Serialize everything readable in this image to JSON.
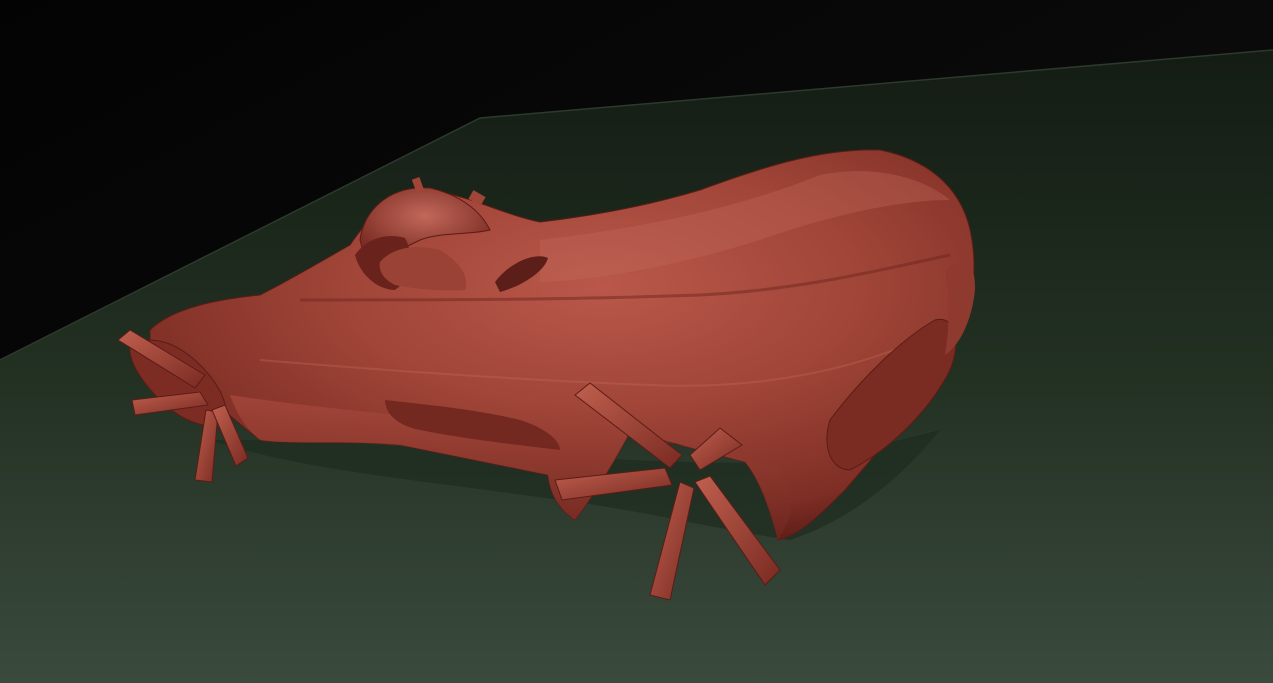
{
  "viewport": {
    "label": "",
    "background_top": "#050605",
    "background_mid": "#101310",
    "floor_top": "#141c14",
    "floor_bottom": "#3a4a3c",
    "floor_edge": "#2c3a2e",
    "material_base": "#9c3f34",
    "material_highlight": "#c46a5c",
    "material_shadow": "#5a1c16"
  },
  "model": {
    "name": "",
    "shape": "sculpted-car-body",
    "parts": [
      "body",
      "canopy",
      "front-vanes",
      "mid-vanes",
      "rear-vanes"
    ]
  }
}
